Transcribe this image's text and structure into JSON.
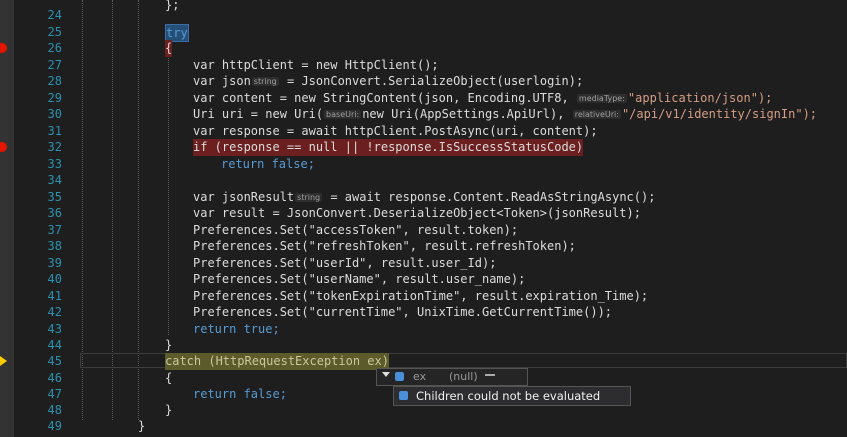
{
  "editor": {
    "lines": [
      {
        "n": "24",
        "text": "};"
      },
      {
        "n": "25",
        "text": "try"
      },
      {
        "n": "26",
        "text": "{"
      },
      {
        "n": "27",
        "text": "var httpClient = new HttpClient();"
      },
      {
        "n": "28",
        "p1": "var json",
        "hint": "string",
        "p2": " = JsonConvert.SerializeObject(userlogin);"
      },
      {
        "n": "29",
        "p1": "var content = new StringContent(json, Encoding.UTF8, ",
        "hint": "mediaType:",
        "p2": "\"application/json\");"
      },
      {
        "n": "30",
        "p1": "Uri uri = new Uri(",
        "hint": "baseUri:",
        "p2": "new Uri(AppSettings.ApiUrl), ",
        "hint2": "relativeUri:",
        "p3": "\"/api/v1/identity/signIn\");"
      },
      {
        "n": "31",
        "text": "var response = await httpClient.PostAsync(uri, content);"
      },
      {
        "n": "32",
        "text": "if (response == null || !response.IsSuccessStatusCode)"
      },
      {
        "n": "33",
        "text": "return false;"
      },
      {
        "n": "34",
        "text": ""
      },
      {
        "n": "35",
        "p1": "var jsonResult",
        "hint": "string",
        "p2": " = await response.Content.ReadAsStringAsync();"
      },
      {
        "n": "36",
        "text": "var result = JsonConvert.DeserializeObject<Token>(jsonResult);"
      },
      {
        "n": "37",
        "text": "Preferences.Set(\"accessToken\", result.token);"
      },
      {
        "n": "38",
        "text": "Preferences.Set(\"refreshToken\", result.refreshToken);"
      },
      {
        "n": "39",
        "text": "Preferences.Set(\"userId\", result.user_Id);"
      },
      {
        "n": "40",
        "text": "Preferences.Set(\"userName\", result.user_name);"
      },
      {
        "n": "41",
        "text": "Preferences.Set(\"tokenExpirationTime\", result.expiration_Time);"
      },
      {
        "n": "42",
        "text": "Preferences.Set(\"currentTime\", UnixTime.GetCurrentTime());"
      },
      {
        "n": "43",
        "text": "return true;"
      },
      {
        "n": "44",
        "text": "}"
      },
      {
        "n": "45",
        "text": "catch (HttpRequestException ex)"
      },
      {
        "n": "46",
        "text": "{"
      },
      {
        "n": "47",
        "text": "return false;"
      },
      {
        "n": "48",
        "text": "}"
      },
      {
        "n": "49",
        "text": "}"
      }
    ]
  },
  "datatip": {
    "var_name": "ex",
    "var_value": "(null)",
    "message": "Children could not be evaluated"
  },
  "colors": {
    "background": "#1e1e1e",
    "keyword": "#569cd6",
    "type": "#4ec9b0",
    "string": "#d69d85",
    "line_number": "#2b91af",
    "breakpoint": "#e51400",
    "current_statement": "#ffcc00"
  },
  "icons": [
    "breakpoint-icon",
    "current-statement-arrow-icon",
    "expand-icon",
    "variable-icon",
    "pin-icon",
    "info-icon"
  ]
}
